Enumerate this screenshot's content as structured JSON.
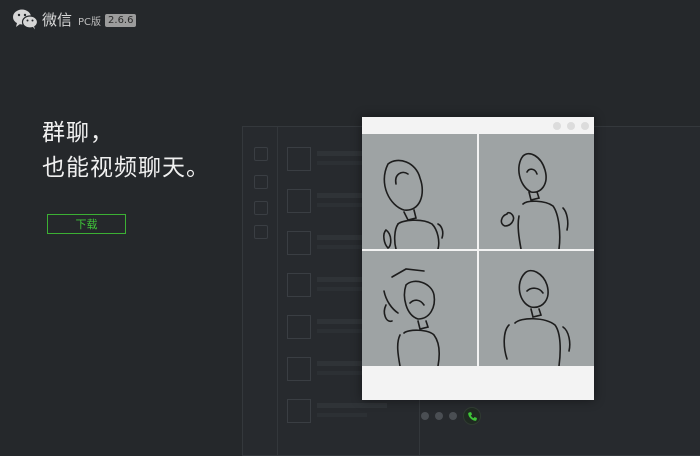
{
  "header": {
    "app_name": "微信",
    "edition": "PC版",
    "version": "2.6.6",
    "logo_icon": "wechat-logo-icon"
  },
  "hero": {
    "line1": "群聊，",
    "line2": "也能视频聊天。",
    "download_label": "下载"
  },
  "video_window": {
    "participants": 4,
    "titlebar_icons": [
      "minimize-icon",
      "maximize-icon",
      "close-icon"
    ]
  },
  "pager": {
    "total": 4,
    "active_index": 3,
    "active_icon": "phone-icon"
  },
  "colors": {
    "background": "#25282b",
    "accent_green": "#3cb034"
  }
}
